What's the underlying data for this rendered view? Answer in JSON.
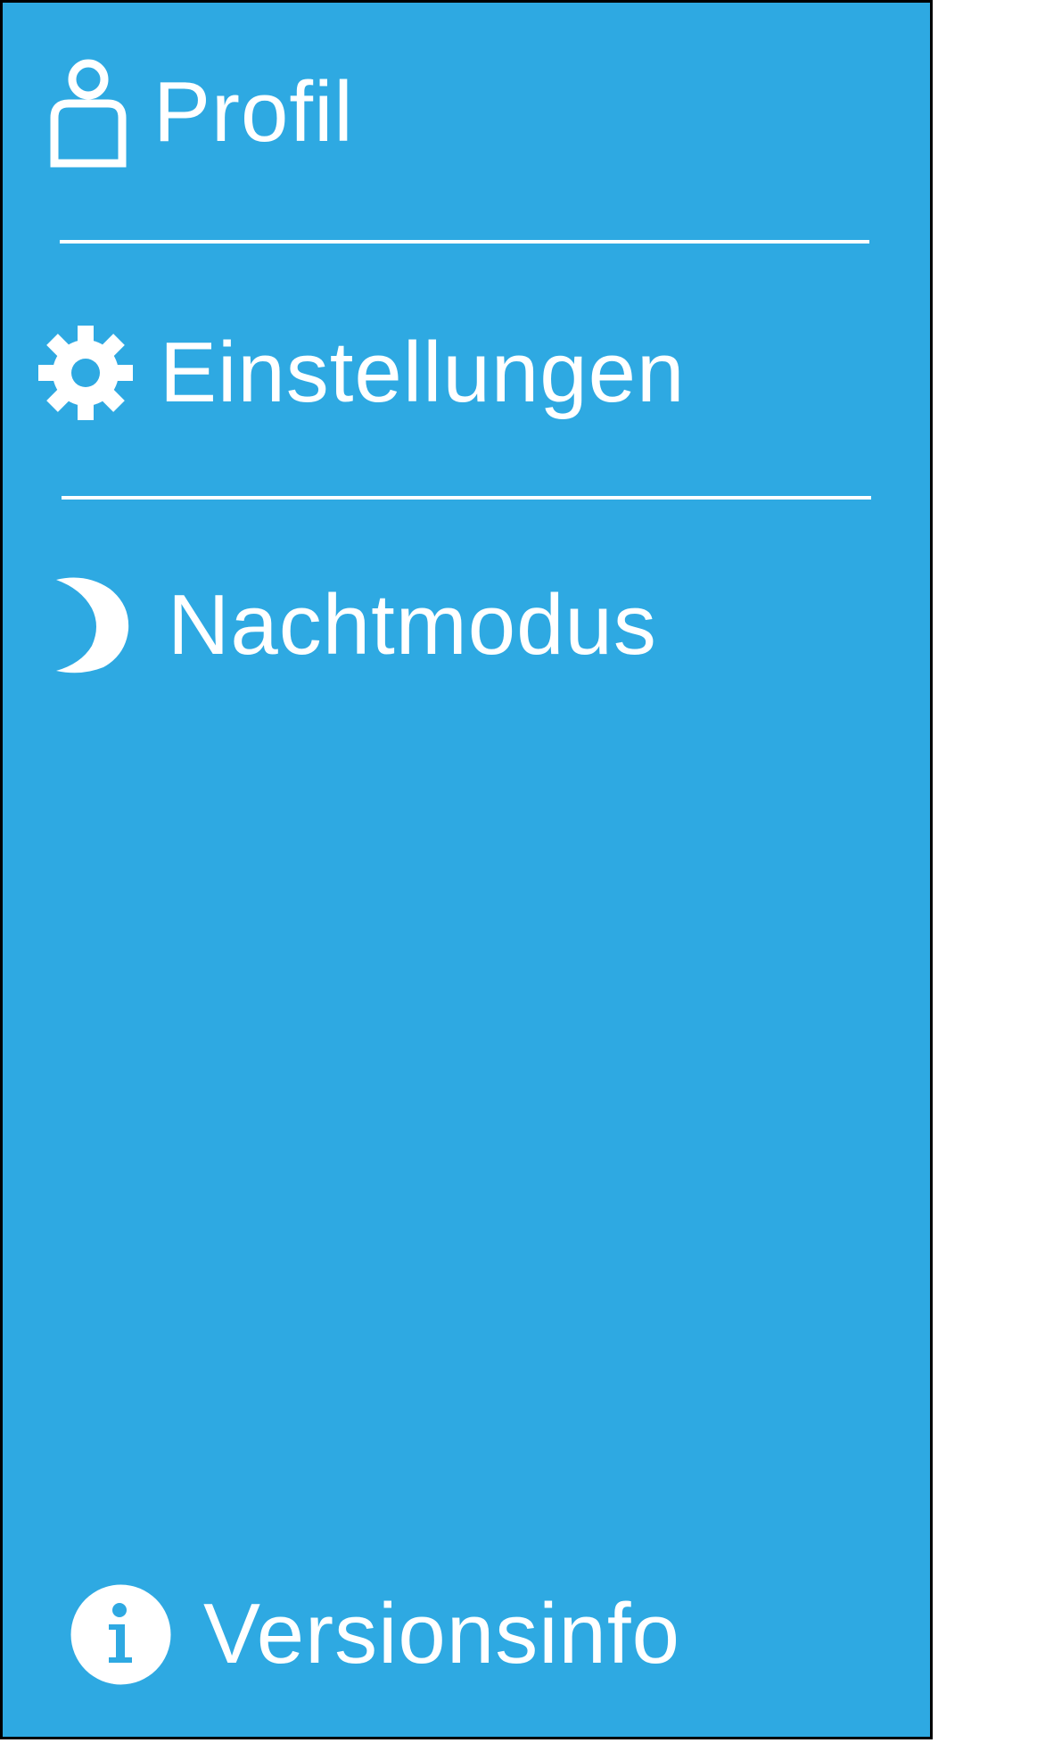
{
  "menu": {
    "items": [
      {
        "label": "Profil",
        "icon": "user-icon"
      },
      {
        "label": "Einstellungen",
        "icon": "gear-icon"
      },
      {
        "label": "Nachtmodus",
        "icon": "moon-icon"
      }
    ],
    "footer": {
      "label": "Versionsinfo",
      "icon": "info-icon"
    }
  },
  "colors": {
    "drawer_background": "#2ea9e2",
    "foreground": "#ffffff",
    "border": "#000000"
  }
}
